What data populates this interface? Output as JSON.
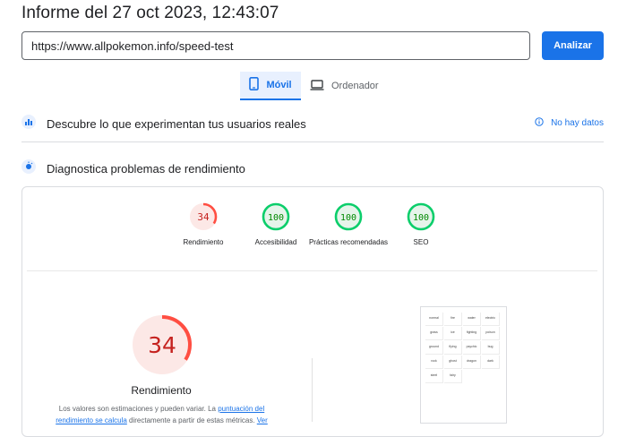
{
  "report": {
    "title": "Informe del 27 oct 2023, 12:43:07"
  },
  "search": {
    "url": "https://www.allpokemon.info/speed-test",
    "button_label": "Analizar"
  },
  "tabs": [
    {
      "label": "Móvil",
      "icon": "smartphone-icon",
      "active": true
    },
    {
      "label": "Ordenador",
      "icon": "laptop-icon",
      "active": false
    }
  ],
  "crux": {
    "title": "Descubre lo que experimentan tus usuarios reales",
    "status": "No hay datos"
  },
  "diagnostics": {
    "title": "Diagnostica problemas de rendimiento"
  },
  "scores": [
    {
      "label": "Rendimiento",
      "value": "34",
      "fraction": 0.34,
      "status": "poor"
    },
    {
      "label": "Accesibilidad",
      "value": "100",
      "fraction": 1.0,
      "status": "good"
    },
    {
      "label": "Prácticas recomendadas",
      "value": "100",
      "fraction": 1.0,
      "status": "good"
    },
    {
      "label": "SEO",
      "value": "100",
      "fraction": 1.0,
      "status": "good"
    }
  ],
  "main_score": {
    "label": "Rendimiento",
    "value": "34",
    "fraction": 0.34,
    "description_prefix": "Los valores son estimaciones y pueden variar. La ",
    "description_link": "puntuación del rendimiento se calcula",
    "description_suffix": " directamente a partir de estas métricas. ",
    "description_link2": "Ver"
  },
  "thumbnail_cells": [
    "normal",
    "fire",
    "water",
    "electric",
    "grass",
    "ice",
    "fighting",
    "poison",
    "ground",
    "flying",
    "psychic",
    "bug",
    "rock",
    "ghost",
    "dragon",
    "dark",
    "steel",
    "fairy"
  ],
  "colors": {
    "accent": "#1a73e8",
    "poor": "#ff4e42",
    "poor_bg": "#fce8e6",
    "poor_text": "#c5221f",
    "good": "#0cce6b",
    "good_bg": "#e6f4ea",
    "good_text": "#008800"
  }
}
